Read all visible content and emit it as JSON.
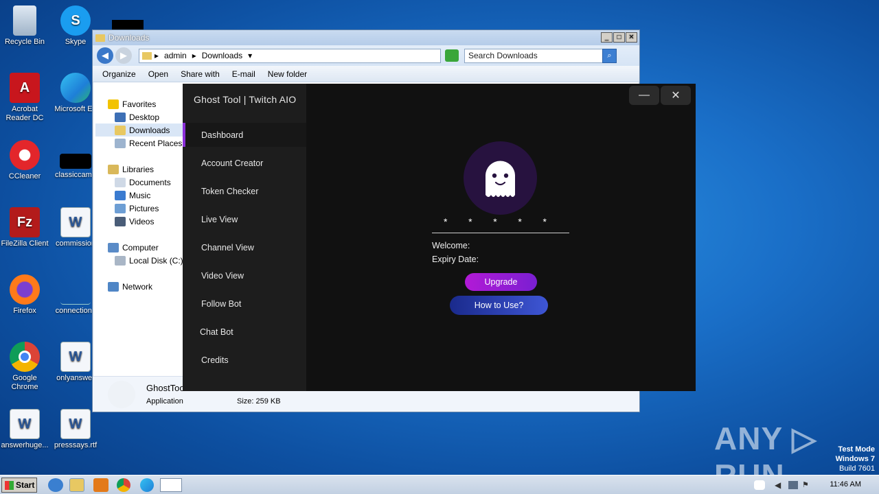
{
  "desktop": {
    "icons": [
      {
        "label": "Recycle Bin",
        "icon": "recycle-bin-icon"
      },
      {
        "label": "Skype",
        "icon": "skype-icon"
      },
      {
        "label": "Acrobat Reader DC",
        "icon": "acrobat-icon"
      },
      {
        "label": "Microsoft Ed",
        "icon": "edge-icon"
      },
      {
        "label": "CCleaner",
        "icon": "ccleaner-icon"
      },
      {
        "label": "classiccame",
        "icon": "file-icon"
      },
      {
        "label": "FileZilla Client",
        "icon": "filezilla-icon"
      },
      {
        "label": "commission",
        "icon": "word-icon"
      },
      {
        "label": "Firefox",
        "icon": "firefox-icon"
      },
      {
        "label": "connectionc",
        "icon": "file-icon"
      },
      {
        "label": "Google Chrome",
        "icon": "chrome-icon"
      },
      {
        "label": "onlyanswer",
        "icon": "word-icon"
      },
      {
        "label": "answerhuge...",
        "icon": "word-icon"
      },
      {
        "label": "presssays.rtf",
        "icon": "word-icon"
      }
    ]
  },
  "explorer": {
    "title": "Downloads",
    "breadcrumb": [
      "admin",
      "Downloads"
    ],
    "search_placeholder": "Search Downloads",
    "toolbar": {
      "organize": "Organize",
      "open": "Open",
      "share_with": "Share with",
      "email": "E-mail",
      "new_folder": "New folder"
    },
    "sidebar": {
      "favorites": "Favorites",
      "desktop": "Desktop",
      "downloads": "Downloads",
      "recent_places": "Recent Places",
      "libraries": "Libraries",
      "documents": "Documents",
      "music": "Music",
      "pictures": "Pictures",
      "videos": "Videos",
      "computer": "Computer",
      "local_disk": "Local Disk (C:)",
      "network": "Network"
    },
    "details": {
      "name": "GhostToo",
      "type": "Application",
      "size": "Size:  259 KB"
    }
  },
  "ghost_tool": {
    "title": "Ghost Tool | Twitch AIO",
    "nav": [
      "Dashboard",
      "Account Creator",
      "Token Checker",
      "Live View",
      "Channel View",
      "Video View",
      "Follow Bot",
      "Chat Bot",
      "Credits"
    ],
    "minimize": "—",
    "close": "✕",
    "stars": [
      "*",
      "*",
      "*",
      "*",
      "*"
    ],
    "welcome_label": "Welcome:",
    "expiry_label": "Expiry Date:",
    "upgrade_label": "Upgrade",
    "howto_label": "How to Use?",
    "accent_color": "#8b2fd9"
  },
  "taskbar": {
    "start_label": "Start",
    "clock": "11:46 AM"
  },
  "system": {
    "test_mode": "Test Mode",
    "os": "Windows 7",
    "build": "Build 7601",
    "watermark": "ANY ▷ RUN"
  }
}
